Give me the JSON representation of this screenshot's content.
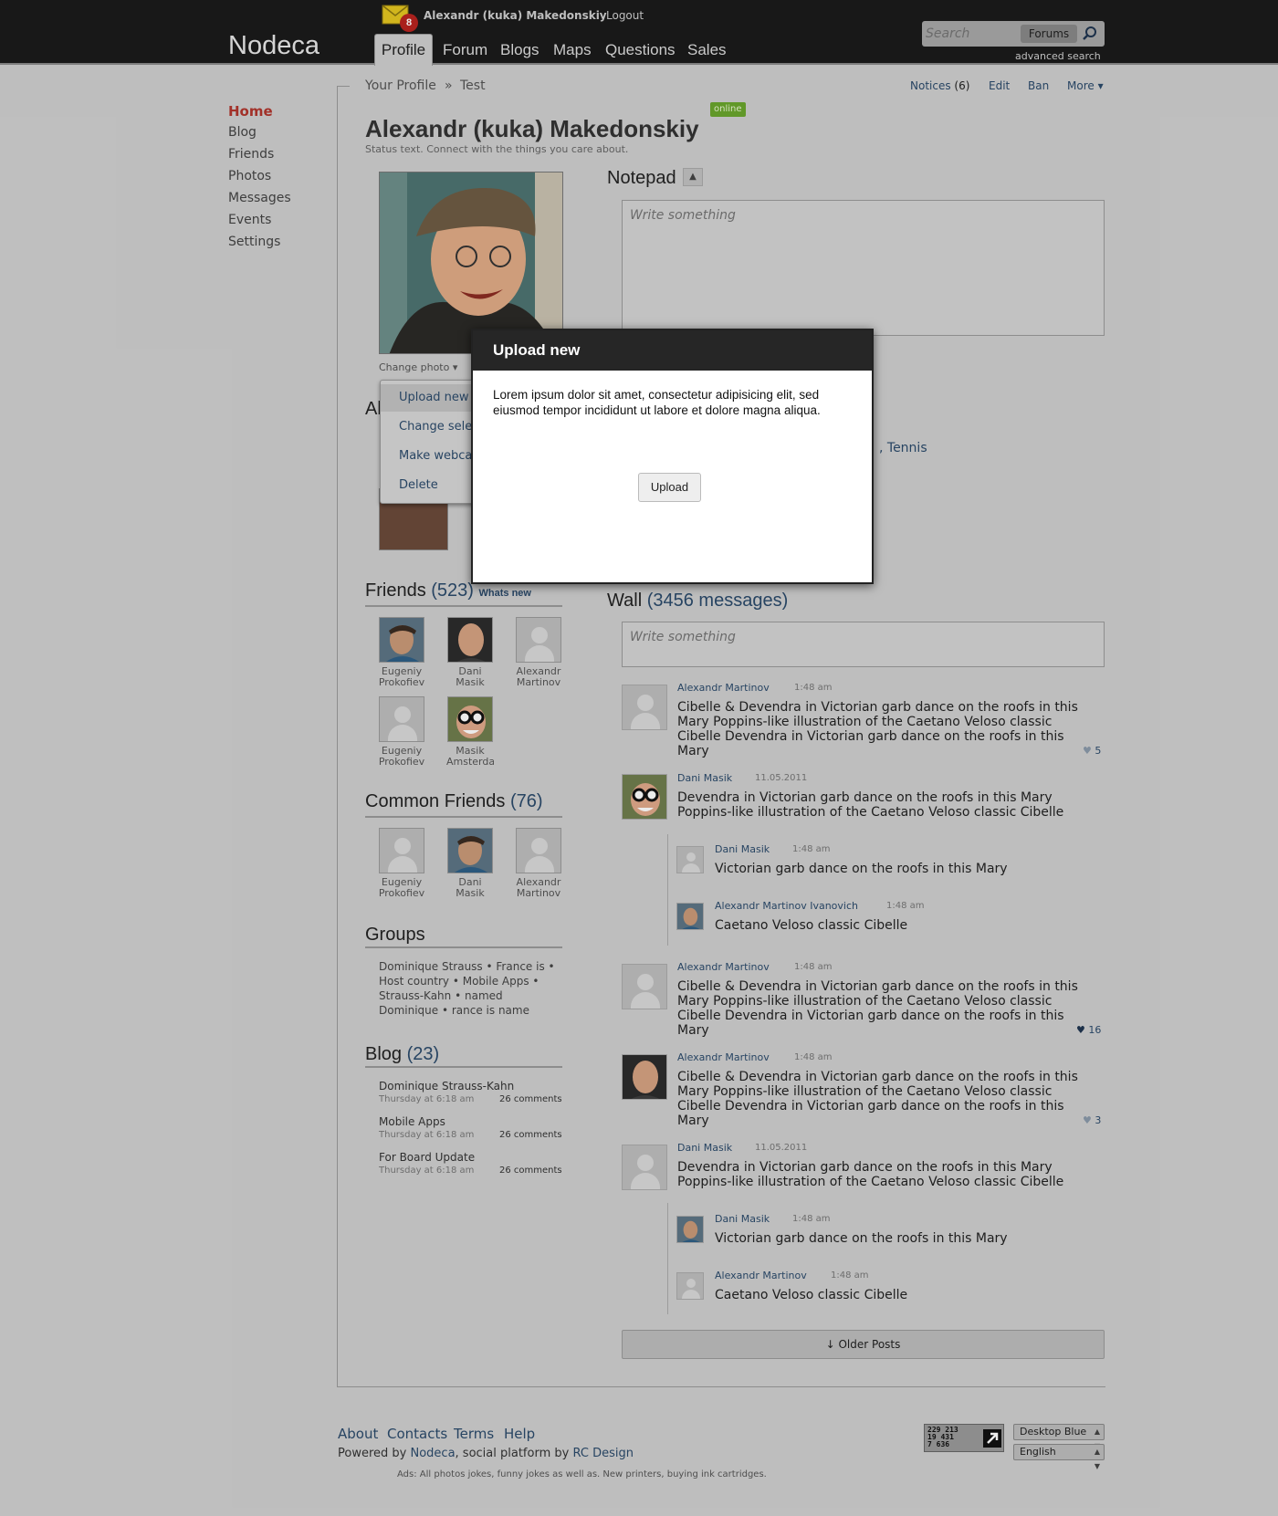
{
  "header": {
    "logo": "Nodeca",
    "mail_count": "8",
    "user_name": "Alexandr (kuka) Makedonskiy",
    "logout": "Logout",
    "tabs": [
      "Profile",
      "Forum",
      "Blogs",
      "Maps",
      "Questions",
      "Sales"
    ],
    "search_placeholder": "Search",
    "search_scope": "Forums",
    "advanced_search": "advanced search"
  },
  "sidebar": {
    "items": [
      "Home",
      "Blog",
      "Friends",
      "Photos",
      "Messages",
      "Events",
      "Settings"
    ],
    "active_color": "#b0362d"
  },
  "breadcrumb": {
    "first": "Your Profile",
    "sep": "»",
    "second": "Test"
  },
  "actions": {
    "notices": "Notices",
    "notices_count": "(6)",
    "edit": "Edit",
    "ban": "Ban",
    "more": "More ▾"
  },
  "profile": {
    "name": "Alexandr (kuka) Makedonskiy",
    "online": "online",
    "status": "Status text. Connect with the things you care about.",
    "change_photo": "Change photo ▾"
  },
  "photo_menu": [
    "Upload new",
    "Change sele",
    "Make webca",
    "Delete"
  ],
  "hidden_text": {
    "section_letter": "Al",
    "tennis": ", Tennis"
  },
  "notepad": {
    "title": "Notepad",
    "placeholder": "Write something"
  },
  "friends": {
    "title": "Friends",
    "count": "(523)",
    "whats_new": "Whats new",
    "list": [
      {
        "first": "Eugeniy",
        "last": "Prokofiev"
      },
      {
        "first": "Dani",
        "last": "Masik"
      },
      {
        "first": "Alexandr",
        "last": "Martinov"
      },
      {
        "first": "Eugeniy",
        "last": "Prokofiev"
      },
      {
        "first": "Masik",
        "last": "Amsterdam"
      }
    ]
  },
  "common_friends": {
    "title": "Common Friends",
    "count": "(76)",
    "list": [
      {
        "first": "Eugeniy",
        "last": "Prokofiev"
      },
      {
        "first": "Dani",
        "last": "Masik"
      },
      {
        "first": "Alexandr",
        "last": "Martinov"
      }
    ]
  },
  "groups": {
    "title": "Groups",
    "lines": [
      "Dominique Strauss • France is  •",
      "Host country • Mobile Apps •",
      "Strauss-Kahn • named",
      "Dominique • rance is name"
    ]
  },
  "blog": {
    "title": "Blog",
    "count": "(23)",
    "items": [
      {
        "title": "Dominique Strauss-Kahn",
        "date": "Thursday at 6:18 am",
        "comments": "26 comments"
      },
      {
        "title": "Mobile Apps",
        "date": "Thursday at 6:18 am",
        "comments": "26 comments"
      },
      {
        "title": "For Board Update",
        "date": "Thursday at 6:18 am",
        "comments": "26 comments"
      }
    ]
  },
  "wall": {
    "title": "Wall",
    "count": "(3456 messages)",
    "placeholder": "Write something",
    "posts": [
      {
        "author": "Alexandr Martinov",
        "time": "1:48 am",
        "text": "Cibelle & Devendra in Victorian garb dance on the roofs in this Mary Poppins-like illustration of the Caetano Veloso classic Cibelle Devendra in Victorian garb dance on the roofs in this Mary",
        "likes": "5"
      },
      {
        "author": "Dani Masik",
        "time": "11.05.2011",
        "text": "Devendra in Victorian garb dance on the roofs in this Mary Poppins-like illustration of the Caetano Veloso classic Cibelle",
        "replies": [
          {
            "author": "Dani Masik",
            "time": "1:48 am",
            "text": "Victorian garb dance on the roofs in this Mary"
          },
          {
            "author": "Alexandr Martinov Ivanovich",
            "time": "1:48 am",
            "text": "Caetano Veloso classic Cibelle"
          }
        ]
      },
      {
        "author": "Alexandr Martinov",
        "time": "1:48 am",
        "text": "Cibelle & Devendra in Victorian garb dance on the roofs in this Mary Poppins-like illustration of the Caetano Veloso classic Cibelle Devendra in Victorian garb dance on the roofs in this Mary",
        "likes": "16"
      },
      {
        "author": "Alexandr Martinov",
        "time": "1:48 am",
        "text": "Cibelle & Devendra in Victorian garb dance on the roofs in this Mary Poppins-like illustration of the Caetano Veloso classic Cibelle Devendra in Victorian garb dance on the roofs in this Mary",
        "likes": "3"
      },
      {
        "author": "Dani Masik",
        "time": "11.05.2011",
        "text": "Devendra in Victorian garb dance on the roofs in this Mary Poppins-like illustration of the Caetano Veloso classic Cibelle",
        "replies": [
          {
            "author": "Dani Masik",
            "time": "1:48 am",
            "text": "Victorian garb dance on the roofs in this Mary"
          },
          {
            "author": "Alexandr Martinov",
            "time": "1:48 am",
            "text": "Caetano Veloso classic Cibelle"
          }
        ]
      }
    ],
    "older": "↓ Older Posts"
  },
  "footer": {
    "links": [
      "About",
      "Contacts",
      "Terms",
      "Help"
    ],
    "powered_prefix": "Powered by",
    "powered_nodeca": "Nodeca",
    "powered_mid": ", social platform by",
    "powered_rc": "RC Design",
    "ads": "Ads: All photos jokes, funny jokes as well as. New printers, buying ink cartridges.",
    "counter": [
      "229 213",
      "19 431",
      "7 636"
    ],
    "theme": "Desktop Blue",
    "language": "English"
  },
  "modal": {
    "title": "Upload new",
    "text": "Lorem ipsum dolor sit amet, consectetur adipisicing elit, sed eiusmod tempor incididunt ut labore et dolore magna aliqua.",
    "button": "Upload"
  }
}
